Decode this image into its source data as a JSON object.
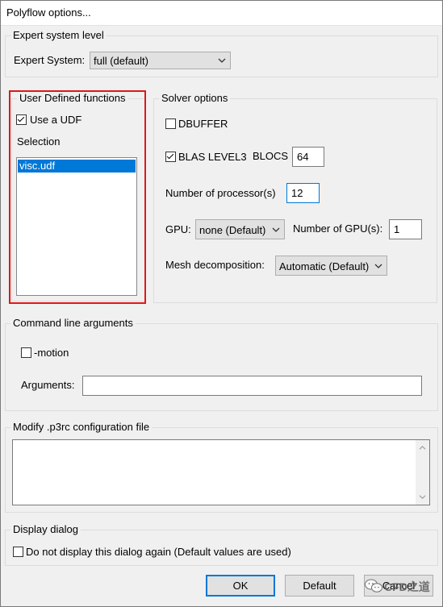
{
  "window": {
    "title": "Polyflow options..."
  },
  "expert": {
    "legend": "Expert system level",
    "label": "Expert System:",
    "value": "full (default)"
  },
  "udf": {
    "legend": "User Defined functions",
    "use_udf_label": "Use a UDF",
    "use_udf_checked": true,
    "selection_label": "Selection",
    "items": [
      "visc.udf"
    ],
    "highlight_color": "#e0161a"
  },
  "solver": {
    "legend": "Solver options",
    "dbuffer_label": "DBUFFER",
    "dbuffer_checked": false,
    "blas_label": "BLAS LEVEL3",
    "blas_checked": true,
    "blocs_label": "BLOCS",
    "blocs_value": "64",
    "processors_label": "Number of processor(s)",
    "processors_value": "12",
    "gpu_label": "GPU:",
    "gpu_value": "none (Default)",
    "gpu_count_label": "Number of GPU(s):",
    "gpu_count_value": "1",
    "mesh_label": "Mesh decomposition:",
    "mesh_value": "Automatic (Default)"
  },
  "cmdline": {
    "legend": "Command line arguments",
    "motion_label": "-motion",
    "motion_checked": false,
    "arguments_label": "Arguments:",
    "arguments_value": ""
  },
  "p3rc": {
    "legend": "Modify .p3rc configuration file",
    "content": ""
  },
  "display": {
    "legend": "Display dialog",
    "no_display_label": "Do not display this dialog again (Default values are used)",
    "no_display_checked": false
  },
  "buttons": {
    "ok": "OK",
    "default": "Default",
    "cancel": "Cancel"
  },
  "watermark": "CFD之道"
}
